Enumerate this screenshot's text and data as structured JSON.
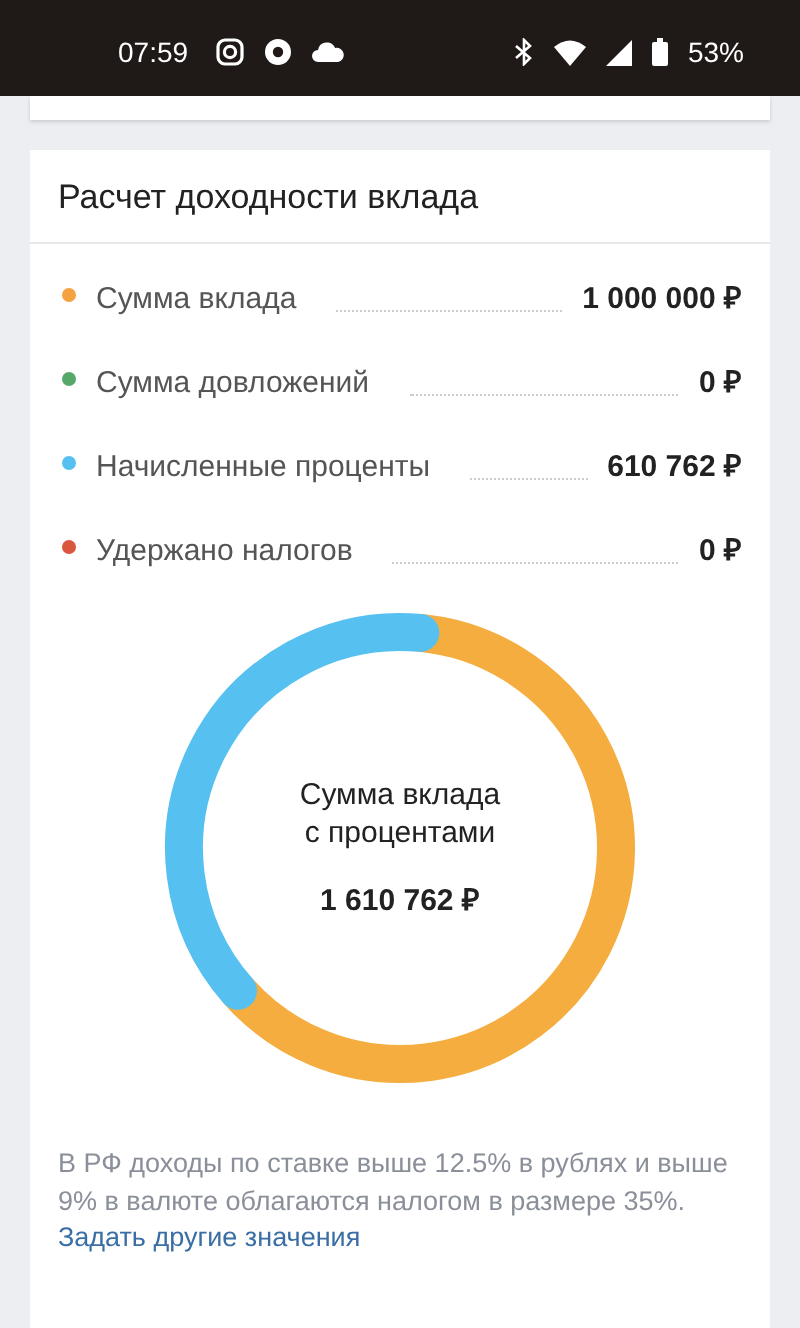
{
  "status_bar": {
    "time": "07:59",
    "battery": "53%"
  },
  "card": {
    "title": "Расчет доходности вклада",
    "rows": [
      {
        "label": "Сумма вклада",
        "value": "1 000 000 ₽",
        "color": "#f4a340"
      },
      {
        "label": "Сумма довложений",
        "value": "0 ₽",
        "color": "#55a868"
      },
      {
        "label": "Начисленные проценты",
        "value": "610 762 ₽",
        "color": "#56c1f1"
      },
      {
        "label": "Удержано налогов",
        "value": "0 ₽",
        "color": "#d9573f"
      }
    ],
    "total_label_1": "Сумма вклада",
    "total_label_2": "с процентами",
    "total": "1 610 762 ₽",
    "note": "В РФ доходы по ставке выше 12.5% в рублях и выше 9% в валюте облагаются налогом в размере 35%.",
    "link": "Задать другие значения"
  }
}
